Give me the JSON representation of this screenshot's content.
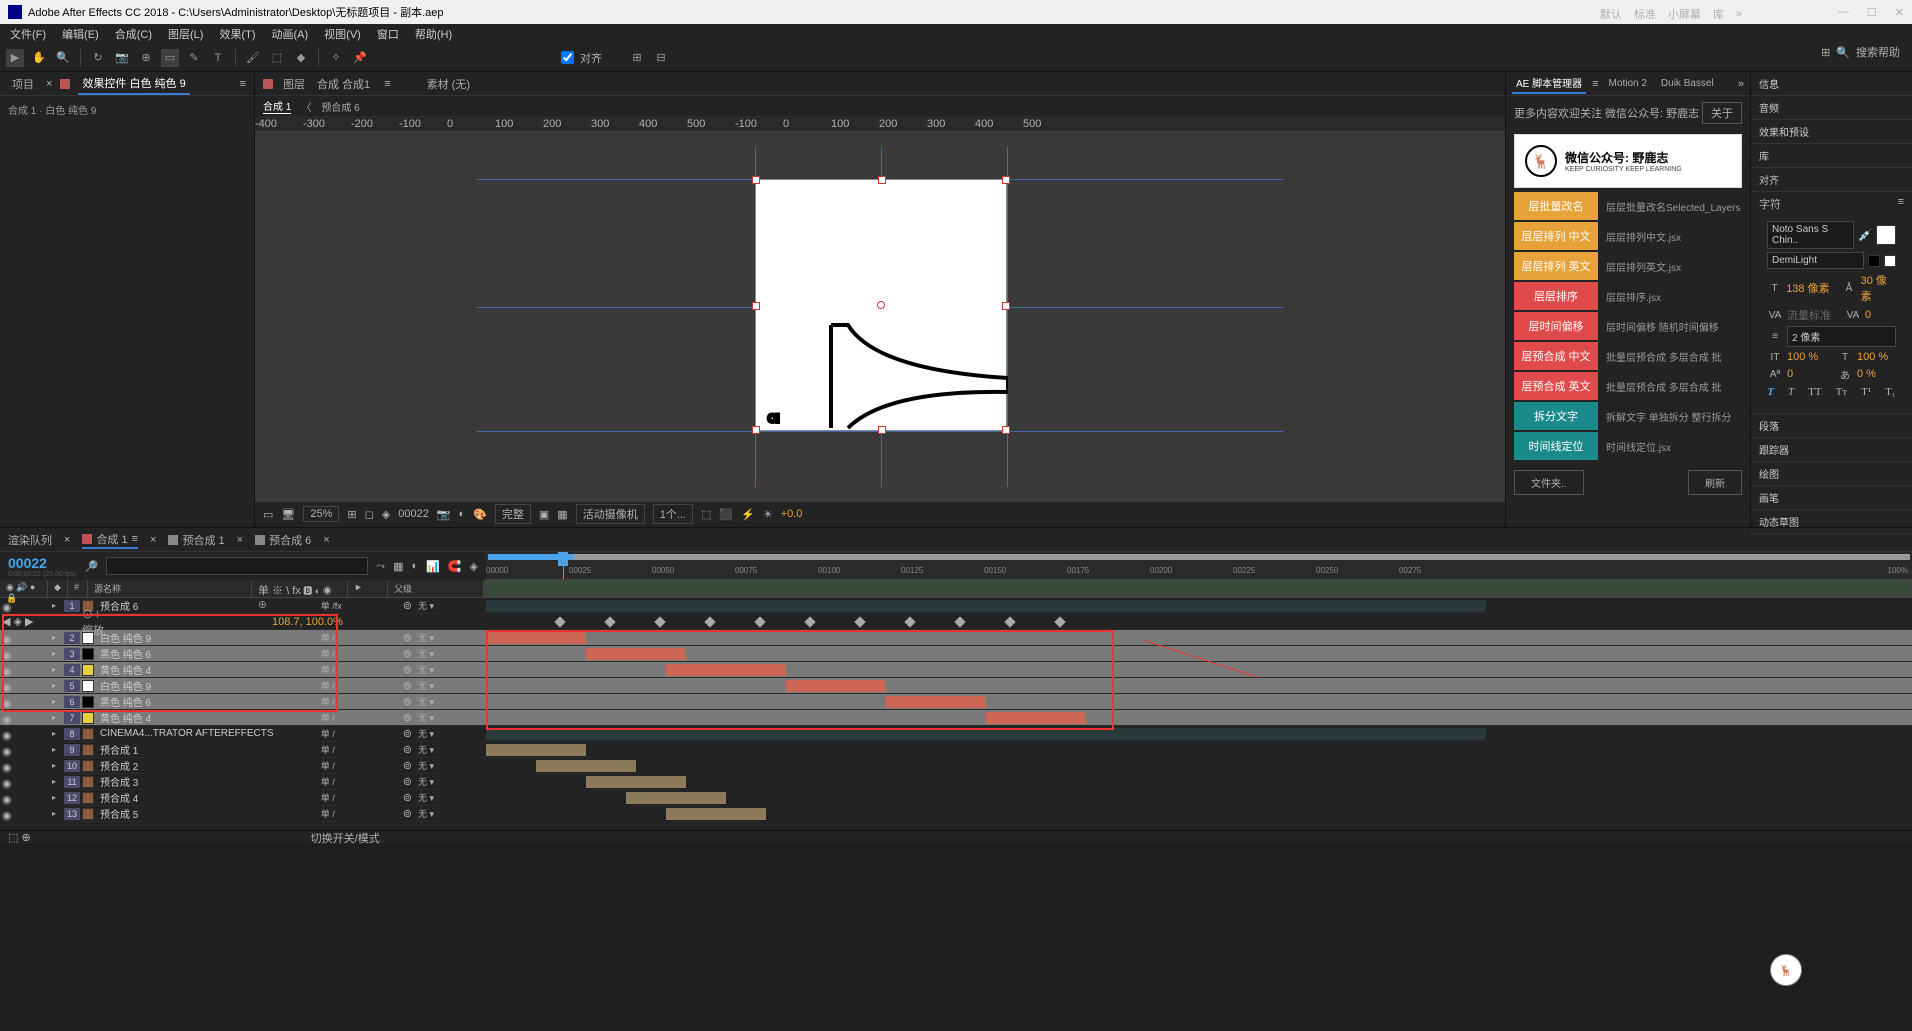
{
  "title": "Adobe After Effects CC 2018 - C:\\Users\\Administrator\\Desktop\\无标题项目 - 副本.aep",
  "menus": [
    "文件(F)",
    "编辑(E)",
    "合成(C)",
    "图层(L)",
    "效果(T)",
    "动画(A)",
    "视图(V)",
    "窗口",
    "帮助(H)"
  ],
  "snap": "对齐",
  "workspace_tabs": [
    "默认",
    "标准",
    "小屏幕",
    "库"
  ],
  "search_help": "搜索帮助",
  "left_panel": {
    "tabs": {
      "proj": "项目",
      "fx": "效果控件 白色 纯色 9"
    },
    "breadcrumb": "合成 1 · 白色 纯色 9"
  },
  "comp": {
    "tabs": {
      "layer": "图层",
      "comp": "合成 合成1",
      "footage": "素材 (无)"
    },
    "subtabs": [
      "合成 1",
      "预合成 6"
    ],
    "ruler": [
      "-400",
      "-300",
      "-200",
      "-100",
      "0",
      "100",
      "200",
      "300",
      "400",
      "500",
      "-100",
      "0",
      "100",
      "200",
      "300",
      "400",
      "500"
    ]
  },
  "viewer_footer": {
    "zoom": "25%",
    "frame": "00022",
    "res": "完整",
    "camera": "活动摄像机",
    "views": "1个...",
    "exp": "+0.0"
  },
  "scripts": {
    "tabs": [
      "AE 脚本管理器",
      "Motion 2",
      "Duik Bassel"
    ],
    "notice": "更多内容欢迎关注 微信公众号: 野鹿志",
    "about": "关于",
    "promo": "微信公众号: 野鹿志",
    "promo_sub": "KEEP CURIOSITY KEEP LEARNING",
    "items": [
      {
        "label": "层批量改名",
        "desc": "层层批量改名Selected_Layers",
        "color": "#e8a23a"
      },
      {
        "label": "层层排列 中文",
        "desc": "层层排列中文.jsx",
        "color": "#e8a23a"
      },
      {
        "label": "层层排列 英文",
        "desc": "层层排列英文.jsx",
        "color": "#e8a23a"
      },
      {
        "label": "层层排序",
        "desc": "层层排序.jsx",
        "color": "#e04a4a"
      },
      {
        "label": "层时间偏移",
        "desc": "层时间偏移 随机时间偏移",
        "color": "#e04a4a"
      },
      {
        "label": "层预合成 中文",
        "desc": "批量层预合成 多层合成 批",
        "color": "#e04a4a"
      },
      {
        "label": "层预合成 英文",
        "desc": "批量层预合成 多层合成 批",
        "color": "#e04a4a"
      },
      {
        "label": "拆分文字",
        "desc": "拆解文字 单独拆分 整行拆分",
        "color": "#1a8a8a"
      },
      {
        "label": "时间线定位",
        "desc": "时间线定位.jsx",
        "color": "#1a8a8a"
      }
    ],
    "folder": "文件夹..",
    "refresh": "刷新"
  },
  "right_panels": [
    "信息",
    "音频",
    "效果和预设",
    "库",
    "对齐"
  ],
  "char": {
    "title": "字符",
    "font": "Noto Sans S Chin..",
    "weight": "DemiLight",
    "size": "138 像素",
    "leading": "30 像素",
    "tracking": "流量标准",
    "kerning": "0",
    "line": "2 像素",
    "vscale": "100 %",
    "hscale": "100 %",
    "baseline": "0",
    "tsume": "0 %"
  },
  "para": [
    "段落",
    "跟踪器",
    "绘图",
    "画笔",
    "动态草图"
  ],
  "timeline": {
    "tabs": [
      {
        "label": "渲染队列",
        "sq": false
      },
      {
        "label": "合成 1",
        "sq": true,
        "active": true
      },
      {
        "label": "预合成 1",
        "sq": true
      },
      {
        "label": "预合成 6",
        "sq": true
      }
    ],
    "timecode": "00022",
    "timecode_sub": "0:00:00:22 (25.00 fps)",
    "ticks": [
      "00000",
      "00025",
      "00050",
      "00075",
      "00100",
      "00125",
      "00150",
      "00175",
      "00200",
      "00225",
      "00250",
      "00275"
    ],
    "scale_end": "100%",
    "cols": {
      "num": "#",
      "src": "源名称",
      "switches": "单 ※ \\ fx",
      "parent": "父级"
    },
    "scale_prop": "缩放",
    "scale_val": "108.7, 100.0%",
    "none": "无",
    "rows": [
      {
        "n": "1",
        "color": "#8a5a3a",
        "name": "预合成 6",
        "sw": "单 /fx",
        "p": "无",
        "bar": [
          0,
          1000
        ],
        "cls": "full",
        "sel": false
      },
      {
        "n": "2",
        "color": "#ffffff",
        "name": "白色 纯色 9",
        "sw": "单 /",
        "p": "无",
        "bar": [
          0,
          100
        ],
        "cls": "red",
        "sel": true
      },
      {
        "n": "3",
        "color": "#000000",
        "name": "黑色 纯色 6",
        "sw": "单 /",
        "p": "无",
        "bar": [
          100,
          200
        ],
        "cls": "red",
        "sel": true
      },
      {
        "n": "4",
        "color": "#e8d040",
        "name": "黄色 纯色 4",
        "sw": "单 /",
        "p": "无",
        "bar": [
          180,
          300
        ],
        "cls": "red",
        "sel": true
      },
      {
        "n": "5",
        "color": "#ffffff",
        "name": "白色 纯色 9",
        "sw": "单 /",
        "p": "无",
        "bar": [
          300,
          400
        ],
        "cls": "red",
        "sel": true
      },
      {
        "n": "6",
        "color": "#000000",
        "name": "黑色 纯色 6",
        "sw": "单 /",
        "p": "无",
        "bar": [
          400,
          500
        ],
        "cls": "red",
        "sel": true
      },
      {
        "n": "7",
        "color": "#e8d040",
        "name": "黄色 纯色 4",
        "sw": "单 /",
        "p": "无",
        "bar": [
          500,
          600
        ],
        "cls": "red",
        "sel": true
      },
      {
        "n": "8",
        "color": "#8a5a3a",
        "name": "CINEMA4...TRATOR AFTEREFFECTS",
        "sw": "单 /",
        "p": "无",
        "bar": [
          0,
          1000
        ],
        "cls": "full",
        "sel": false
      },
      {
        "n": "9",
        "color": "#8a5a3a",
        "name": "预合成 1",
        "sw": "单 /",
        "p": "无",
        "bar": [
          0,
          100
        ],
        "cls": "",
        "sel": false
      },
      {
        "n": "10",
        "color": "#8a5a3a",
        "name": "预合成 2",
        "sw": "单 /",
        "p": "无",
        "bar": [
          50,
          150
        ],
        "cls": "",
        "sel": false
      },
      {
        "n": "11",
        "color": "#8a5a3a",
        "name": "预合成 3",
        "sw": "单 /",
        "p": "无",
        "bar": [
          100,
          200
        ],
        "cls": "",
        "sel": false
      },
      {
        "n": "12",
        "color": "#8a5a3a",
        "name": "预合成 4",
        "sw": "单 /",
        "p": "无",
        "bar": [
          140,
          240
        ],
        "cls": "",
        "sel": false
      },
      {
        "n": "13",
        "color": "#8a5a3a",
        "name": "预合成 5",
        "sw": "单 /",
        "p": "无",
        "bar": [
          180,
          280
        ],
        "cls": "",
        "sel": false
      }
    ],
    "footer": "切换开关/模式"
  }
}
